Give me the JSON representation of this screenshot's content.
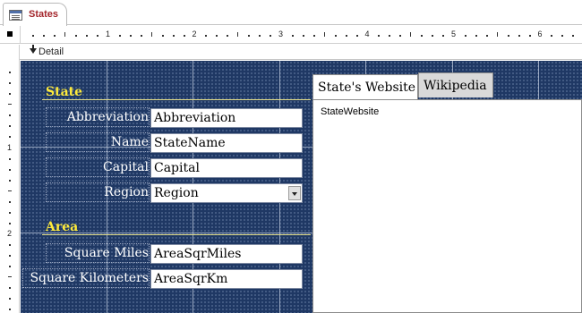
{
  "window": {
    "tab_title": "States",
    "section_label": "Detail"
  },
  "ruler": {
    "top_numbers": [
      "1",
      "2",
      "3",
      "4",
      "5",
      "6"
    ],
    "left_numbers": [
      "1",
      "2"
    ]
  },
  "form": {
    "state_section": {
      "heading": "State",
      "fields": [
        {
          "label": "Abbreviation",
          "value": "Abbreviation"
        },
        {
          "label": "Name",
          "value": "StateName"
        },
        {
          "label": "Capital",
          "value": "Capital"
        },
        {
          "label": "Region",
          "value": "Region"
        }
      ]
    },
    "area_section": {
      "heading": "Area",
      "fields": [
        {
          "label": "Square Miles",
          "value": "AreaSqrMiles"
        },
        {
          "label": "Square Kilometers",
          "value": "AreaSqrKm"
        }
      ]
    },
    "tab_control": {
      "tabs": [
        {
          "label": "State's Website",
          "active": true
        },
        {
          "label": "Wikipedia",
          "active": false
        }
      ],
      "page_field": "StateWebsite"
    }
  },
  "colors": {
    "canvas_background": "#1f3864",
    "heading_color": "#ffeb3b",
    "tab_title_color": "#a4262c"
  },
  "icons": {
    "form_icon": "form-icon",
    "section_arrow": "section-arrow-icon",
    "combo_dropdown": "dropdown-arrow-icon"
  }
}
